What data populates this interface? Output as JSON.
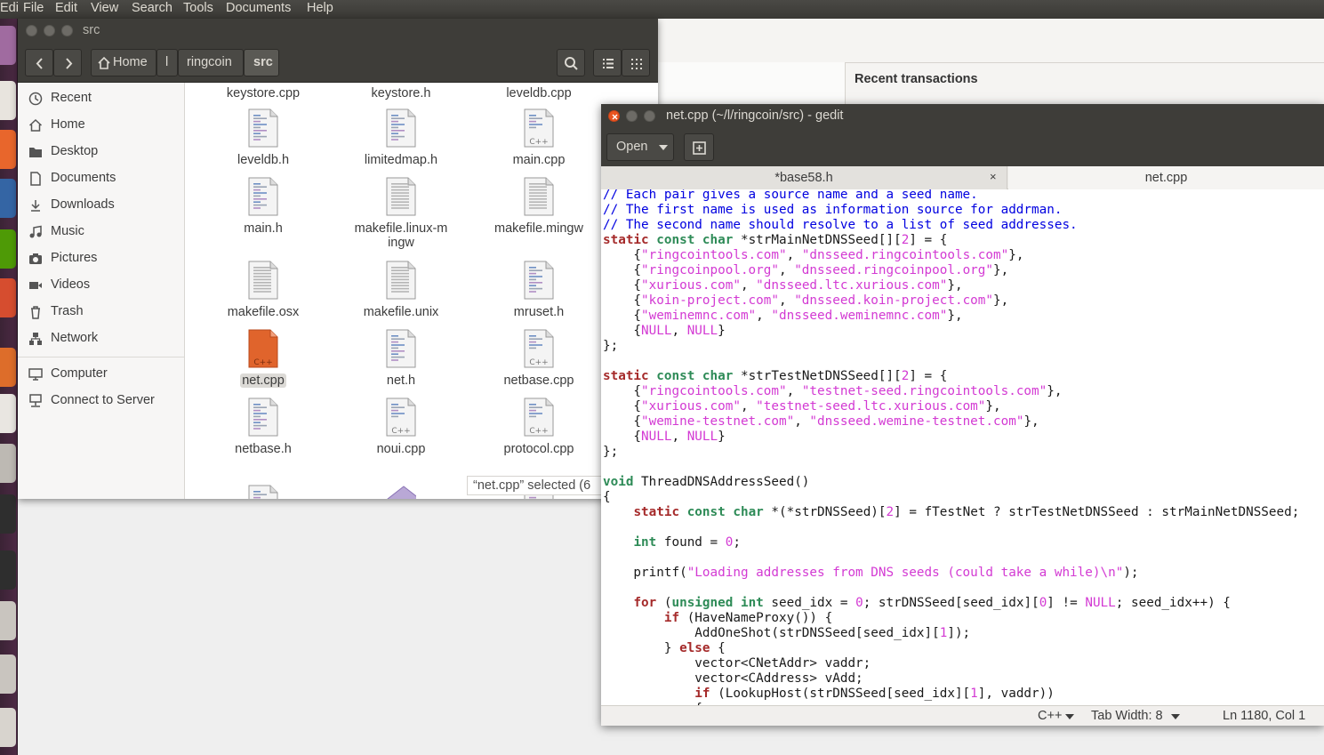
{
  "topbar": {
    "app_fragment": "Edi",
    "menus": [
      "File",
      "Edit",
      "View",
      "Search",
      "Tools",
      "Documents",
      "Help"
    ]
  },
  "background_app": {
    "recent_transactions": "Recent transactions"
  },
  "nautilus": {
    "window_title": "src",
    "breadcrumb": [
      "Home",
      "l",
      "ringcoin",
      "src"
    ],
    "sidebar": [
      {
        "label": "Recent",
        "icon": "clock-icon"
      },
      {
        "label": "Home",
        "icon": "home-icon"
      },
      {
        "label": "Desktop",
        "icon": "folder-icon"
      },
      {
        "label": "Documents",
        "icon": "document-icon"
      },
      {
        "label": "Downloads",
        "icon": "download-icon"
      },
      {
        "label": "Music",
        "icon": "music-icon"
      },
      {
        "label": "Pictures",
        "icon": "camera-icon"
      },
      {
        "label": "Videos",
        "icon": "video-icon"
      },
      {
        "label": "Trash",
        "icon": "trash-icon"
      },
      {
        "label": "Network",
        "icon": "network-icon"
      },
      {
        "label": "Computer",
        "icon": "computer-icon"
      },
      {
        "label": "Connect to Server",
        "icon": "server-icon"
      }
    ],
    "files": [
      {
        "name": "keystore.cpp",
        "type": "text"
      },
      {
        "name": "keystore.h",
        "type": "text"
      },
      {
        "name": "leveldb.cpp",
        "type": "text"
      },
      {
        "name": "leveldb.h",
        "type": "code"
      },
      {
        "name": "limitedmap.h",
        "type": "code"
      },
      {
        "name": "main.cpp",
        "type": "cpp"
      },
      {
        "name": "main.h",
        "type": "code"
      },
      {
        "name": "makefile.linux-mingw",
        "type": "text"
      },
      {
        "name": "makefile.mingw",
        "type": "text"
      },
      {
        "name": "makefile.osx",
        "type": "text"
      },
      {
        "name": "makefile.unix",
        "type": "text"
      },
      {
        "name": "mruset.h",
        "type": "code"
      },
      {
        "name": "net.cpp",
        "type": "cpp-selected"
      },
      {
        "name": "net.h",
        "type": "code"
      },
      {
        "name": "netbase.cpp",
        "type": "cpp"
      },
      {
        "name": "netbase.h",
        "type": "code"
      },
      {
        "name": "noui.cpp",
        "type": "cpp"
      },
      {
        "name": "protocol.cpp",
        "type": "cpp"
      }
    ],
    "status": "“net.cpp” selected  (6"
  },
  "gedit": {
    "window_title": "net.cpp (~/l/ringcoin/src) - gedit",
    "open_label": "Open",
    "tabs": [
      "*base58.h",
      "net.cpp"
    ],
    "tab_close": "×",
    "status": {
      "language": "C++",
      "tab_width": "Tab Width: 8",
      "position": "Ln 1180, Col 1"
    }
  }
}
